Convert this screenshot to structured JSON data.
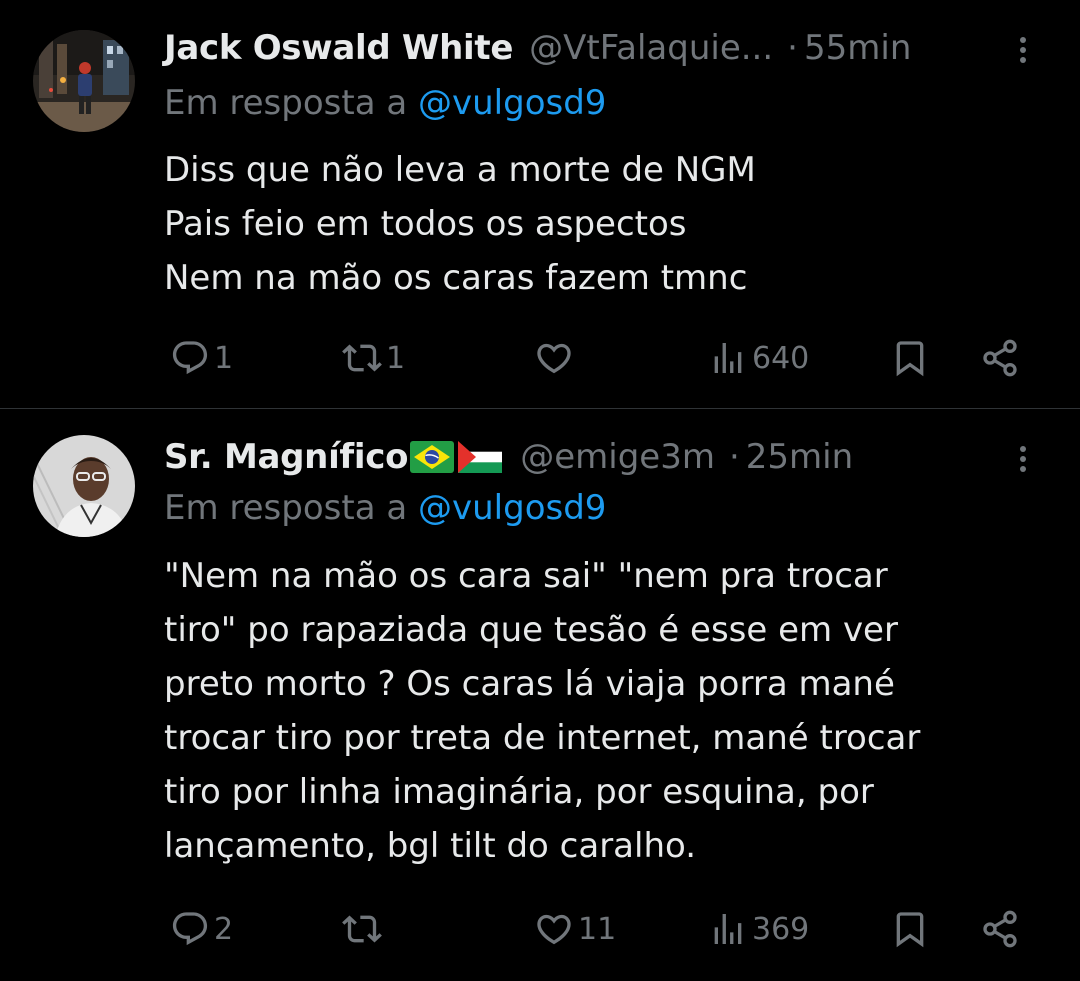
{
  "tweets": [
    {
      "author_name": "Jack Oswald White",
      "author_handle": "@VtFalaquie...",
      "time": "55min",
      "reply_prefix": "Em resposta a",
      "reply_mention": "@vulgosd9",
      "text_lines": [
        "Diss que não leva a morte de NGM",
        "Pais feio em todos os aspectos",
        "Nem na mão os caras fazem tmnc"
      ],
      "replies": "1",
      "retweets": "1",
      "likes": "",
      "views": "640"
    },
    {
      "author_name": "Sr. Magnífico",
      "author_flags": [
        "brazil-flag",
        "palestine-flag"
      ],
      "author_handle": "@emige3m",
      "time": "25min",
      "reply_prefix": "Em resposta a",
      "reply_mention": "@vulgosd9",
      "text_lines": [
        "\"Nem na mão os cara sai\" \"nem pra trocar",
        "tiro\" po rapaziada que tesão é esse em ver",
        "preto morto ? Os caras lá viaja porra mané",
        "trocar tiro por treta de internet, mané trocar",
        "tiro por linha imaginária, por esquina, por",
        "lançamento, bgl tilt do caralho."
      ],
      "replies": "2",
      "retweets": "",
      "likes": "11",
      "views": "369"
    }
  ],
  "icons": {
    "reply": "reply-icon",
    "retweet": "retweet-icon",
    "like": "heart-icon",
    "views": "views-icon",
    "bookmark": "bookmark-icon",
    "share": "share-icon",
    "more": "more-icon"
  },
  "colors": {
    "background": "#000000",
    "text": "#e7e9ea",
    "secondary": "#71767b",
    "mention": "#1d9bf0",
    "divider": "#2f3336"
  }
}
